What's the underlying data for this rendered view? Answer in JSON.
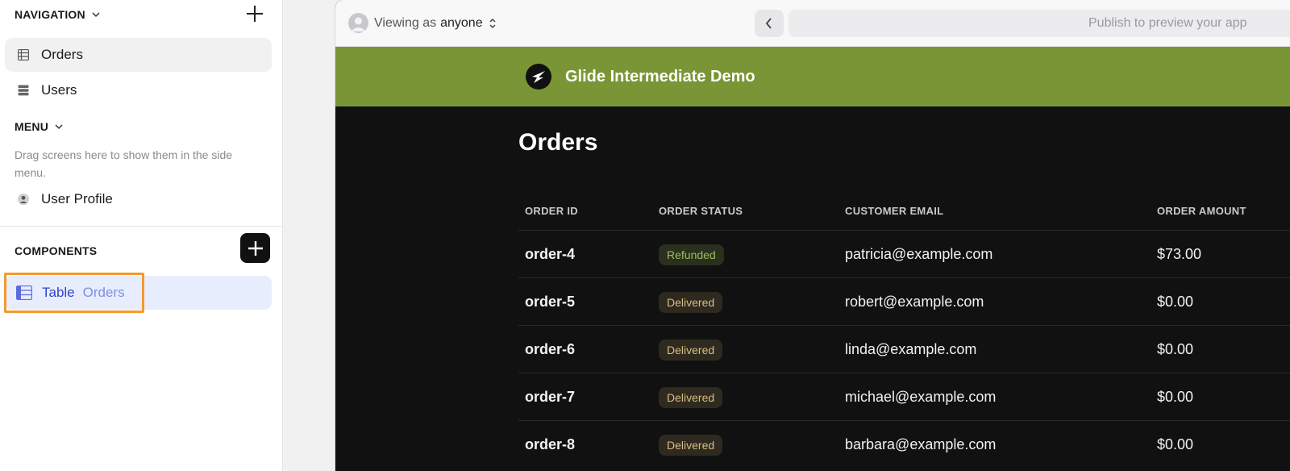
{
  "sidebar": {
    "navigation": {
      "header": "NAVIGATION",
      "items": [
        {
          "label": "Orders",
          "icon": "table-icon",
          "active": true
        },
        {
          "label": "Users",
          "icon": "database-icon",
          "active": false
        }
      ]
    },
    "menu": {
      "header": "MENU",
      "hint": "Drag screens here to show them in the side menu.",
      "items": [
        {
          "label": "User Profile",
          "icon": "user-icon"
        }
      ]
    },
    "components": {
      "header": "COMPONENTS",
      "items": [
        {
          "label": "Table",
          "sub": "Orders",
          "icon": "table-icon"
        }
      ]
    }
  },
  "preview": {
    "viewing_prefix": "Viewing as",
    "viewing_user": "anyone",
    "url_placeholder": "Publish to preview your app",
    "app_title": "Glide Intermediate Demo",
    "page_title": "Orders",
    "brand_color": "#7a9535",
    "table": {
      "columns": [
        "ORDER ID",
        "ORDER STATUS",
        "CUSTOMER EMAIL",
        "ORDER AMOUNT"
      ],
      "rows": [
        {
          "id": "order-4",
          "status": "Refunded",
          "email": "patricia@example.com",
          "amount": "$73.00"
        },
        {
          "id": "order-5",
          "status": "Delivered",
          "email": "robert@example.com",
          "amount": "$0.00"
        },
        {
          "id": "order-6",
          "status": "Delivered",
          "email": "linda@example.com",
          "amount": "$0.00"
        },
        {
          "id": "order-7",
          "status": "Delivered",
          "email": "michael@example.com",
          "amount": "$0.00"
        },
        {
          "id": "order-8",
          "status": "Delivered",
          "email": "barbara@example.com",
          "amount": "$0.00"
        }
      ]
    }
  },
  "accent_highlight_color": "#f39a2d"
}
